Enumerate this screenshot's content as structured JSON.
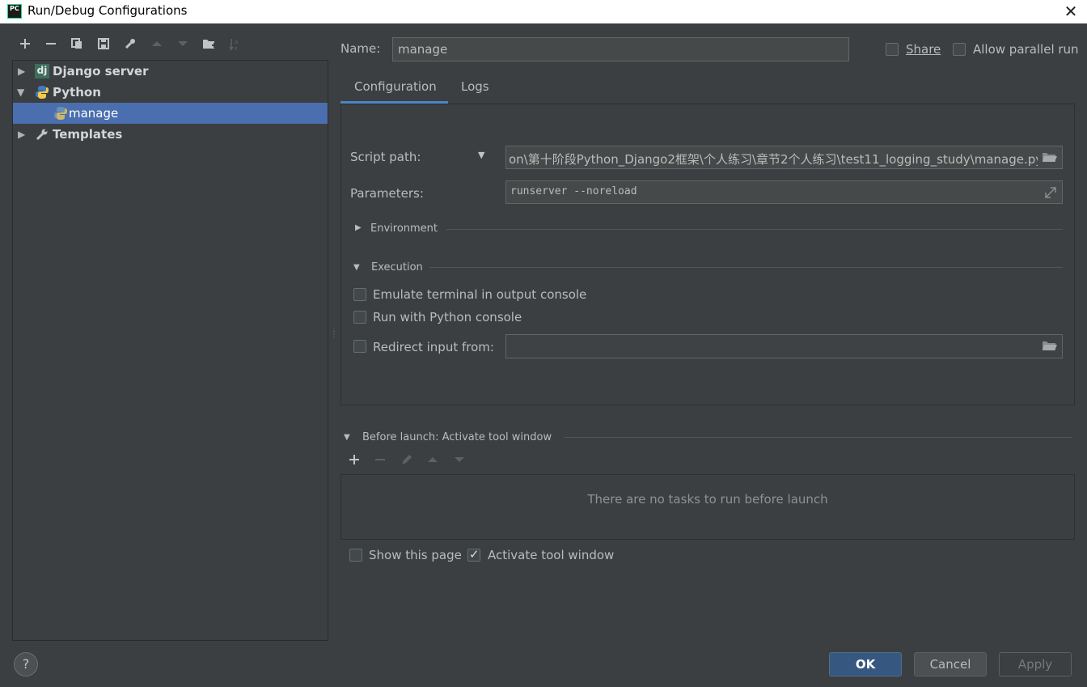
{
  "window": {
    "title": "Run/Debug Configurations",
    "app_icon_text": "PC"
  },
  "toolbar": {
    "icons": [
      "plus-icon",
      "minus-icon",
      "copy-icon",
      "save-icon",
      "wrench-icon",
      "arrow-up-icon",
      "arrow-down-icon",
      "new-folder-icon",
      "sort-alpha-icon"
    ]
  },
  "tree": {
    "items": [
      {
        "label": "Django server",
        "icon": "django-icon",
        "expanded": false
      },
      {
        "label": "Python",
        "icon": "python-icon",
        "expanded": true
      },
      {
        "label": "manage",
        "icon": "python-icon",
        "selected": true
      },
      {
        "label": "Templates",
        "icon": "wrench-icon",
        "expanded": false
      }
    ]
  },
  "config": {
    "name_label": "Name:",
    "name_value": "manage",
    "share_label": "Share",
    "parallel_label": "Allow parallel run",
    "tabs": [
      "Configuration",
      "Logs"
    ],
    "script_path_label": "Script path:",
    "script_path_value": "on\\第十阶段Python_Django2框架\\个人练习\\章节2个人练习\\test11_logging_study\\manage.py",
    "parameters_label": "Parameters:",
    "parameters_value": "runserver --noreload",
    "environment_label": "Environment",
    "execution_label": "Execution",
    "emulate_terminal_label": "Emulate terminal in output console",
    "python_console_label": "Run with Python console",
    "redirect_input_label": "Redirect input from:",
    "redirect_input_value": ""
  },
  "before_launch": {
    "label": "Before launch: Activate tool window",
    "empty_text": "There are no tasks to run before launch"
  },
  "bottom": {
    "show_page_label": "Show this page",
    "activate_tool_label": "Activate tool window",
    "activate_tool_checked": true,
    "ok_label": "OK",
    "cancel_label": "Cancel",
    "apply_label": "Apply",
    "help_label": "?"
  }
}
